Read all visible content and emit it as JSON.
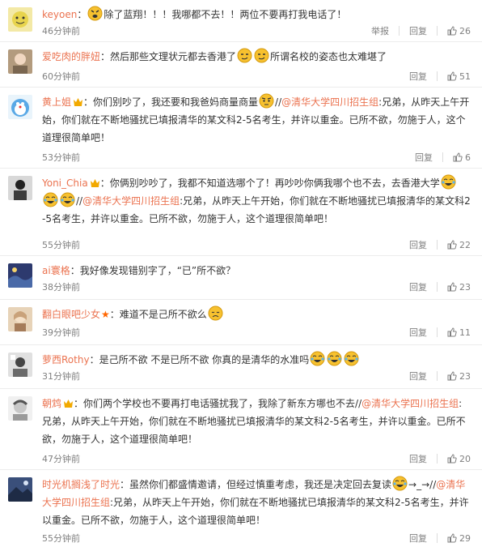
{
  "actions": {
    "report": "举报",
    "reply": "回复"
  },
  "comments": [
    {
      "user": "keyoen",
      "sep": "：",
      "segs": [
        "除了蓝翔！！！我哪都不去！！两位不要再打我电话了！"
      ],
      "time": "46分钟前",
      "likes": "26",
      "avatar_color": "#e8d44d"
    },
    {
      "user": "爱吃肉的胖妞",
      "sep": "：",
      "segs": [
        "然后那些文理状元都去香港了",
        "所谓名校的姿态也太难堪了"
      ],
      "time": "60分钟前",
      "likes": "51",
      "avatar_color": "#7a6650"
    },
    {
      "user": "黄上姐",
      "sep": "：",
      "segs": [
        "你们别吵了，我还要和我爸妈商量商量",
        "//",
        "@清华大学四川招生组",
        ":兄弟，从昨天上午开始，你们就在不断地骚扰已填报清华的某文科2-5名考生，并许以重金。已所不欲，勿施于人，这个道理很简单吧！"
      ],
      "time": "53分钟前",
      "likes": "6",
      "avatar_color": "#5aa9e6"
    },
    {
      "user": "Yoni_Chia",
      "sep": "：",
      "segs": [
        "你俩别吵吵了，我都不知道选哪个了！再吵吵你俩我哪个也不去，去香港大学",
        "//",
        "@清华大学四川招生组",
        ":兄弟，从昨天上午开始，你们就在不断地骚扰已填报清华的某文科2-5名考生，并许以重金。已所不欲，勿施于人，这个道理很简单吧！"
      ],
      "time": "55分钟前",
      "likes": "22",
      "avatar_color": "#3c3c3c"
    },
    {
      "user": "ai寰格",
      "sep": "：",
      "segs": [
        "我好像发现错别字了，“已”所不欲？"
      ],
      "time": "38分钟前",
      "likes": "23",
      "avatar_color": "#2d3a6e"
    },
    {
      "user": "翻白眼吧少女",
      "sep": "：",
      "segs": [
        "难道不是己所不欲么"
      ],
      "time": "39分钟前",
      "likes": "11",
      "avatar_color": "#c9a27a"
    },
    {
      "user": "萝西Rothy",
      "sep": "：",
      "segs": [
        "是己所不欲 不是已所不欲 你真的是清华的水准吗"
      ],
      "time": "31分钟前",
      "likes": "23",
      "avatar_color": "#6b6b6b"
    },
    {
      "user": "朝鸩",
      "sep": "：",
      "segs": [
        "你们两个学校也不要再打电话骚扰我了，我除了新东方哪也不去",
        "//",
        "@清华大学四川招生组",
        ":兄弟，从昨天上午开始，你们就在不断地骚扰已填报清华的某文科2-5名考生，并许以重金。已所不欲，勿施于人，这个道理很简单吧！"
      ],
      "time": "47分钟前",
      "likes": "20",
      "avatar_color": "#9a9a9a"
    },
    {
      "user": "时光机搁浅了时光",
      "sep": "：",
      "segs": [
        "虽然你们都盛情邀请，但经过慎重考虑，我还是决定回去复读",
        "→_→",
        "//",
        "@清华大学四川招生组",
        ":兄弟，从昨天上午开始，你们就在不断地骚扰已填报清华的某文科2-5名考生，并许以重金。已所不欲，勿施于人，这个道理很简单吧！"
      ],
      "time": "55分钟前",
      "likes": "29",
      "avatar_color": "#3a4f7a"
    }
  ]
}
